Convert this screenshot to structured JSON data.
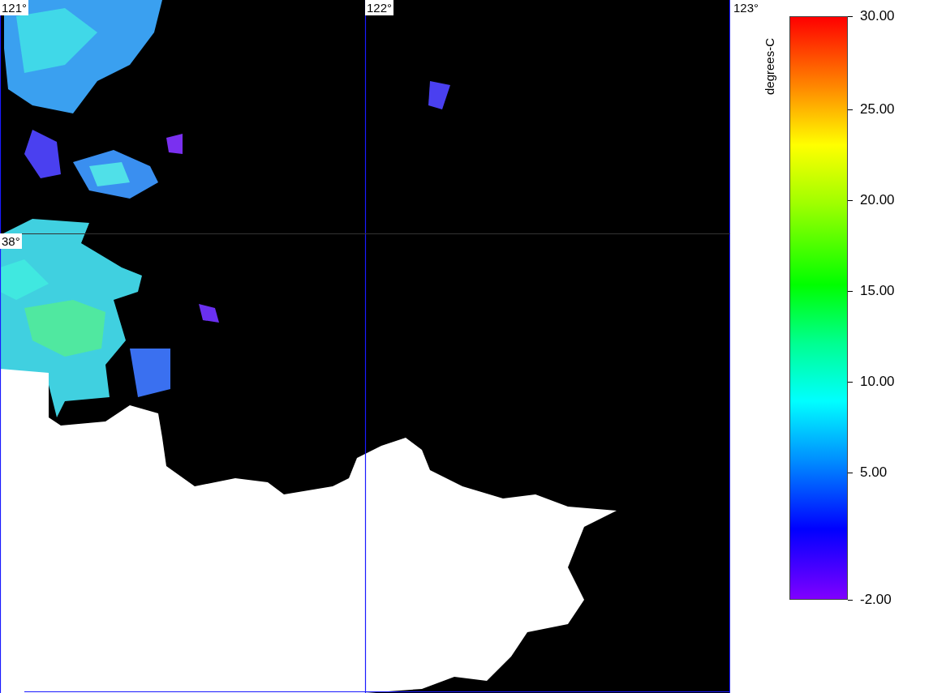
{
  "map": {
    "grid_labels": [
      {
        "text": "121°",
        "kind": "top"
      },
      {
        "text": "122°",
        "kind": "top"
      },
      {
        "text": "123°",
        "kind": "top"
      },
      {
        "text": "38°",
        "kind": "left"
      }
    ]
  },
  "colorbar": {
    "title": "degrees-C",
    "ticks": [
      "30.00",
      "25.00",
      "20.00",
      "15.00",
      "10.00",
      "5.00",
      "-2.00"
    ]
  }
}
